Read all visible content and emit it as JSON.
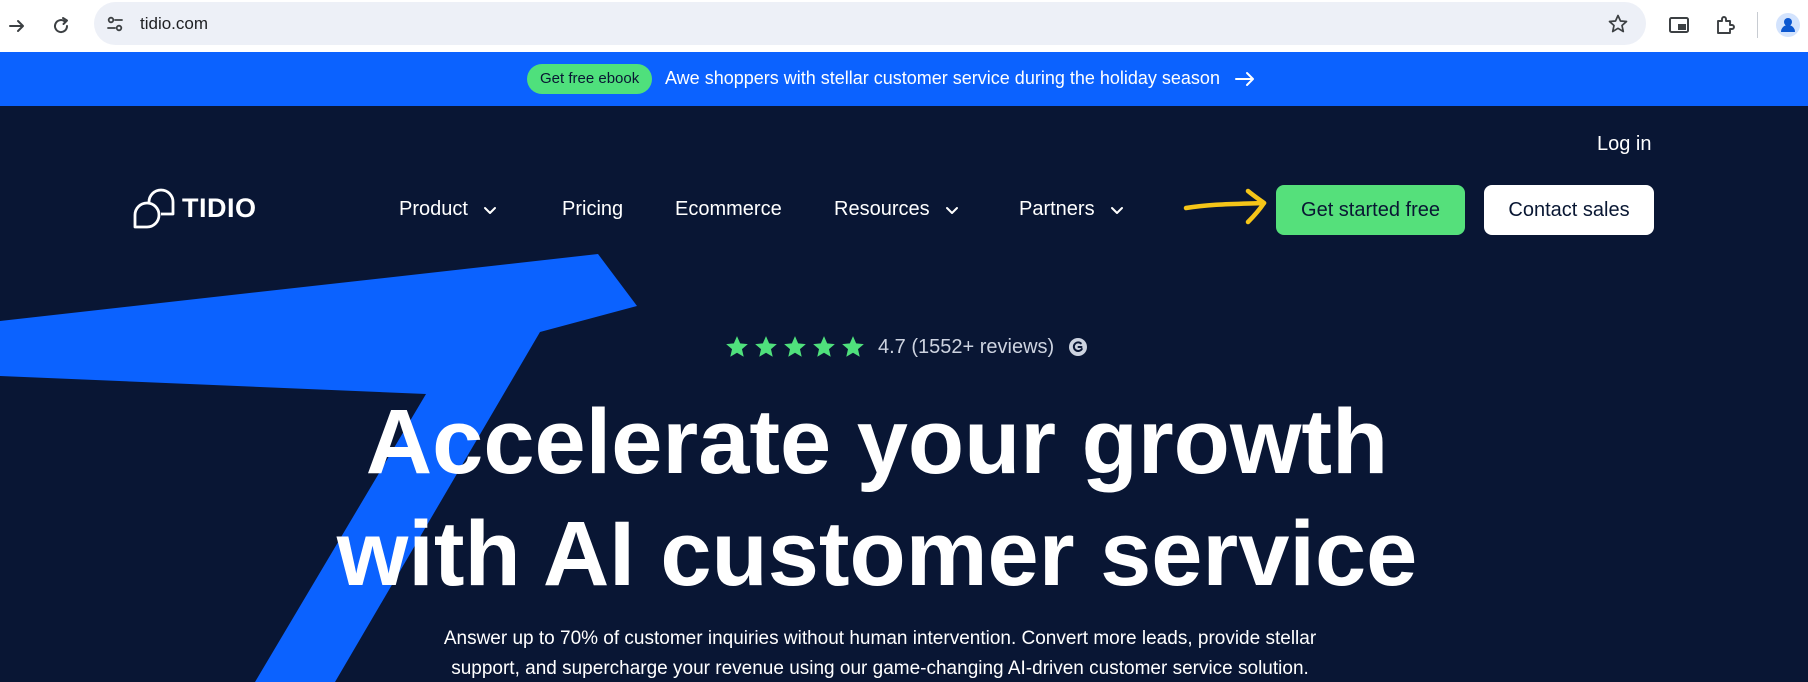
{
  "browser": {
    "url": "tidio.com"
  },
  "promo": {
    "pill_label": "Get free ebook",
    "text": "Awe shoppers with stellar customer service during the holiday season"
  },
  "header": {
    "login": "Log in",
    "logo": "TIDIO",
    "nav": [
      {
        "label": "Product",
        "has_dropdown": true
      },
      {
        "label": "Pricing",
        "has_dropdown": false
      },
      {
        "label": "Ecommerce",
        "has_dropdown": false
      },
      {
        "label": "Resources",
        "has_dropdown": true
      },
      {
        "label": "Partners",
        "has_dropdown": true
      }
    ],
    "cta_primary": "Get started free",
    "cta_secondary": "Contact sales"
  },
  "hero": {
    "rating": "4.7 (1552+ reviews)",
    "stars": 5,
    "headline_line1": "Accelerate your growth",
    "headline_line2": "with AI customer service",
    "sub_line1": "Answer up to 70% of customer inquiries without human intervention. Convert more leads, provide stellar",
    "sub_line2": "support, and supercharge your revenue using our game-changing AI-driven customer service solution."
  },
  "colors": {
    "promo_blue": "#0b62ff",
    "hero_bg": "#091634",
    "cta_green": "#55e07b",
    "annotation_yellow": "#f5c518"
  }
}
